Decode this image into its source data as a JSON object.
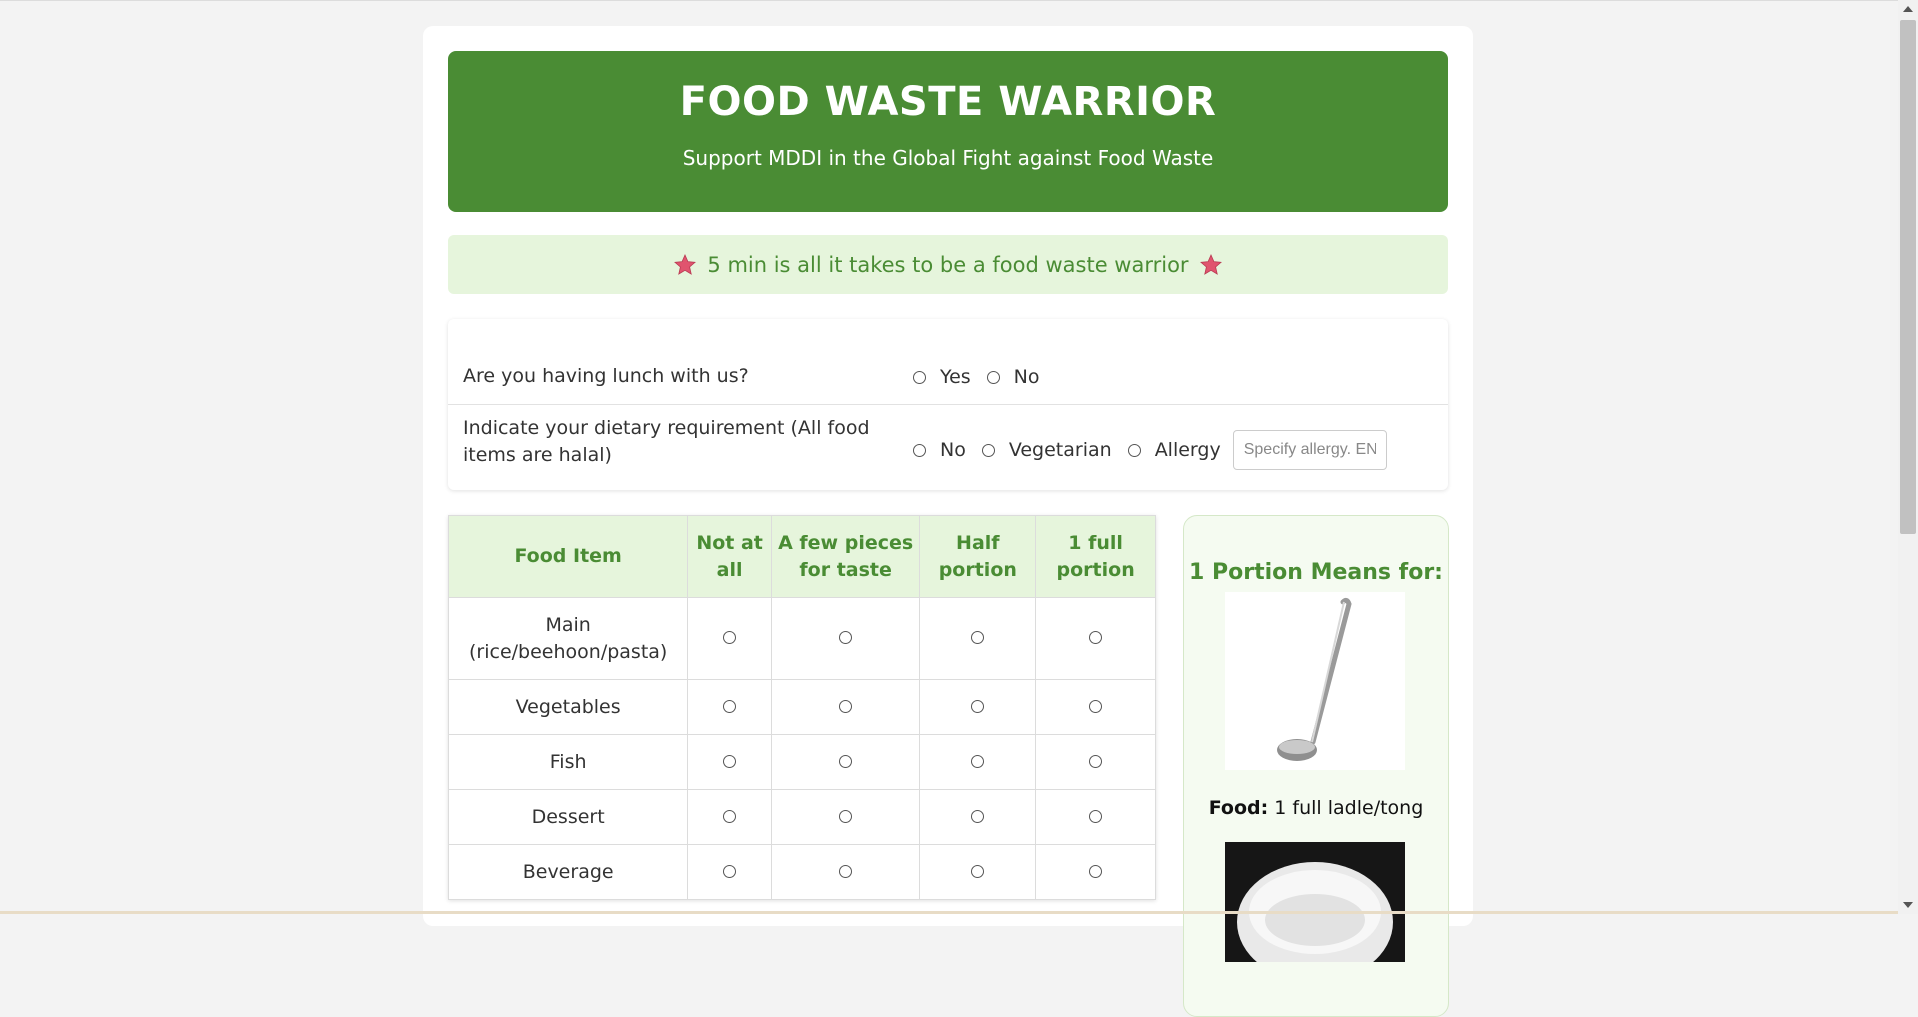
{
  "header": {
    "title": "FOOD WASTE WARRIOR",
    "subtitle": "Support MDDI in the Global Fight against Food Waste"
  },
  "banner": {
    "text": "5 min is all it takes to be a food waste warrior",
    "icon": "star-icon"
  },
  "questions": {
    "lunch": {
      "label": "Are you having lunch with us?",
      "options": [
        "Yes",
        "No"
      ]
    },
    "dietary": {
      "label": "Indicate your dietary requirement (All food items are halal)",
      "options": [
        "No",
        "Vegetarian",
        "Allergy"
      ],
      "allergy_placeholder": "Specify allergy. ENTER"
    }
  },
  "portion_table": {
    "headers": [
      "Food Item",
      "Not at all",
      "A few pieces for taste",
      "Half portion",
      "1 full portion"
    ],
    "rows": [
      "Main (rice/beehoon/pasta)",
      "Vegetables",
      "Fish",
      "Dessert",
      "Beverage"
    ]
  },
  "side_panel": {
    "title": "1 Portion Means for:",
    "food_label": "Food:",
    "food_text": "1 full ladle/tong"
  },
  "colors": {
    "brand_green": "#4a8c34",
    "light_green": "#e6f5dc"
  }
}
